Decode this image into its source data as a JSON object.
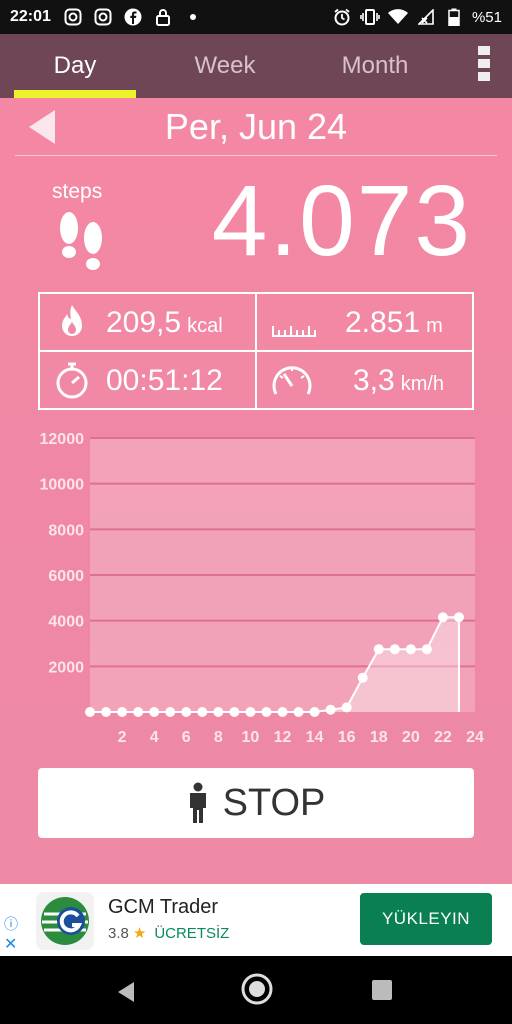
{
  "status_bar": {
    "time": "22:01",
    "battery": "%51",
    "icons": [
      "instagram-icon",
      "instagram-icon",
      "facebook-icon",
      "lock-icon",
      "dot-icon",
      "alarm-icon",
      "vibrate-icon",
      "wifi-icon",
      "no-signal-icon",
      "battery-icon"
    ]
  },
  "tabs": [
    {
      "label": "Day",
      "active": true
    },
    {
      "label": "Week",
      "active": false
    },
    {
      "label": "Month",
      "active": false
    }
  ],
  "date": "Per, Jun 24",
  "steps": {
    "label": "steps",
    "count": "4.073"
  },
  "stats": {
    "calories": {
      "value": "209,5",
      "unit": "kcal"
    },
    "distance": {
      "value": "2.851",
      "unit": "m"
    },
    "duration": {
      "value": "00:51:12"
    },
    "speed": {
      "value": "3,3",
      "unit": "km/h"
    }
  },
  "chart_data": {
    "type": "area",
    "x": [
      0,
      1,
      2,
      3,
      4,
      5,
      6,
      7,
      8,
      9,
      10,
      11,
      12,
      13,
      14,
      15,
      16,
      17,
      18,
      19,
      20,
      21,
      22,
      23
    ],
    "y": [
      0,
      0,
      0,
      0,
      0,
      0,
      0,
      0,
      0,
      0,
      0,
      0,
      0,
      0,
      0,
      100,
      200,
      1500,
      2750,
      2750,
      2750,
      2750,
      4150,
      4150
    ],
    "x_ticks": [
      "2",
      "4",
      "6",
      "8",
      "10",
      "12",
      "14",
      "16",
      "18",
      "20",
      "22",
      "24"
    ],
    "y_ticks": [
      "2000",
      "4000",
      "6000",
      "8000",
      "10000",
      "12000"
    ],
    "xlim": [
      0,
      24
    ],
    "ylim": [
      0,
      12000
    ],
    "grid": true
  },
  "stop_button": {
    "label": "STOP"
  },
  "ad": {
    "title": "GCM Trader",
    "rating": "3.8",
    "price": "ÜCRETSİZ",
    "install_label": "YÜKLEYIN",
    "info_icon": "ⓘ",
    "close_icon": "✕"
  },
  "colors": {
    "background": "#f08aa5",
    "tab_bar": "#6f4656",
    "tab_indicator": "#ecf12b",
    "install_button": "#0a7f52"
  }
}
